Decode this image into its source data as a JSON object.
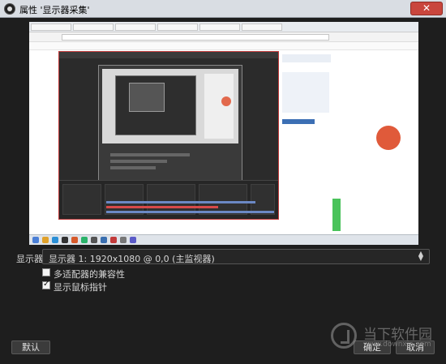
{
  "window": {
    "title": "属性 '显示器采集'",
    "close_glyph": "✕"
  },
  "property": {
    "label": "显示器",
    "selected_value": "显示器 1: 1920x1080 @ 0,0 (主监视器)",
    "options": [
      "显示器 1: 1920x1080 @ 0,0 (主监视器)"
    ]
  },
  "checkboxes": [
    {
      "label": "多适配器的兼容性",
      "checked": false
    },
    {
      "label": "显示鼠标指针",
      "checked": true
    }
  ],
  "buttons": {
    "defaults": "默认",
    "ok": "确定",
    "cancel": "取消"
  },
  "watermark": {
    "text": "当下软件园",
    "url": "www.downxia.com"
  },
  "colors": {
    "dialog_bg": "#1e1e1e",
    "titlebar_bg": "#d9dde3",
    "close_button": "#c9463d",
    "obs_frame_border": "#c23b3b"
  }
}
